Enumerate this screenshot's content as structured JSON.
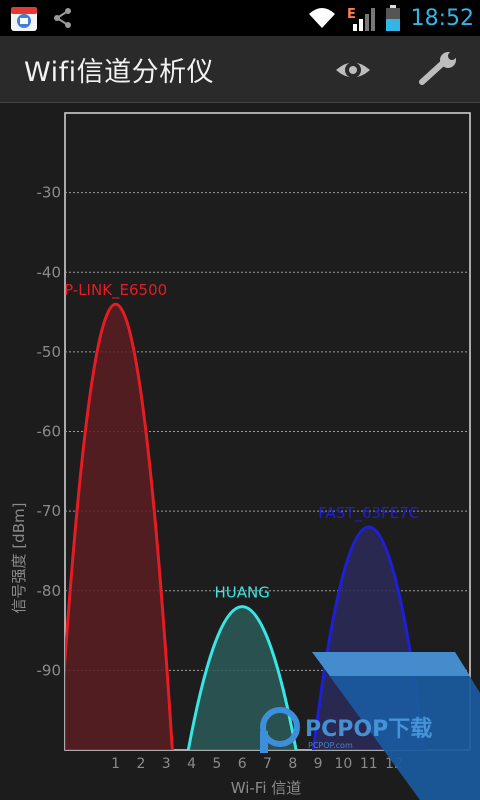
{
  "status_bar": {
    "time": "18:52",
    "network_type": "E"
  },
  "app": {
    "title": "Wifi信道分析仪"
  },
  "icons": {
    "eye": "eye-icon",
    "wrench": "wrench-icon",
    "share": "share-icon",
    "wifi": "wifi-icon",
    "signal": "signal-icon",
    "battery": "battery-icon",
    "app_notification": "app-notification-icon"
  },
  "colors": {
    "accent": "#33b5e5",
    "red_network": "#e51c23",
    "cyan_network": "#39e6e6",
    "blue_network": "#1f1fd6"
  },
  "chart_data": {
    "type": "area",
    "xlabel": "Wi-Fi 信道",
    "ylabel": "信号强度 [dBm]",
    "xlim": [
      -1,
      15
    ],
    "ylim": [
      -100,
      -20
    ],
    "x_ticks": [
      {
        "value": 1,
        "label": "1"
      },
      {
        "value": 2,
        "label": "2"
      },
      {
        "value": 3,
        "label": "3"
      },
      {
        "value": 4,
        "label": "4"
      },
      {
        "value": 5,
        "label": "5"
      },
      {
        "value": 6,
        "label": "6"
      },
      {
        "value": 7,
        "label": "7"
      },
      {
        "value": 8,
        "label": "8"
      },
      {
        "value": 9,
        "label": "9"
      },
      {
        "value": 10,
        "label": "10"
      },
      {
        "value": 11,
        "label": "11"
      },
      {
        "value": 12,
        "label": "12"
      }
    ],
    "y_ticks": [
      {
        "value": -30,
        "label": "-30"
      },
      {
        "value": -40,
        "label": "-40"
      },
      {
        "value": -50,
        "label": "-50"
      },
      {
        "value": -60,
        "label": "-60"
      },
      {
        "value": -70,
        "label": "-70"
      },
      {
        "value": -80,
        "label": "-80"
      },
      {
        "value": -90,
        "label": "-90"
      }
    ],
    "grid": true,
    "series": [
      {
        "name": "P-LINK_E6500",
        "channel": 1,
        "signal": -44,
        "color": "#e51c23",
        "fill": "#5a1d22"
      },
      {
        "name": "HUANG",
        "channel": 6,
        "signal": -82,
        "color": "#39e6e6",
        "fill": "#2b5a58"
      },
      {
        "name": "FAST_63FE7C",
        "channel": 11,
        "signal": -72,
        "color": "#1f1fd6",
        "fill": "#2a2a5a"
      }
    ]
  },
  "watermark": {
    "brand": "PCPOP下载",
    "sub": "PCPOP.com"
  }
}
